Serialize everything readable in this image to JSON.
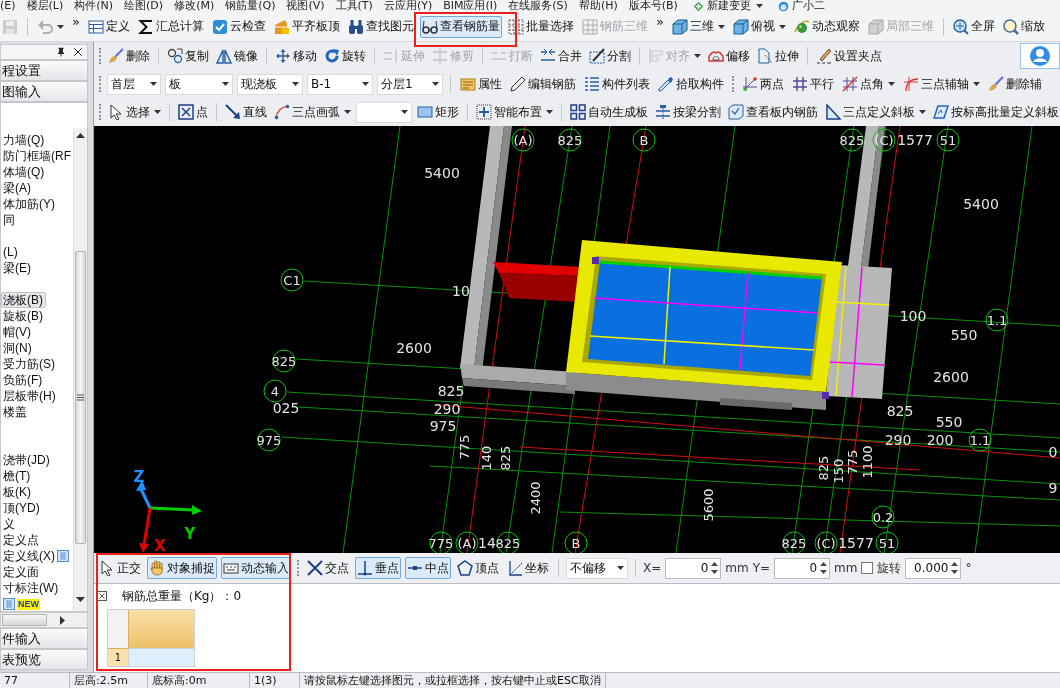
{
  "menu_bar": {
    "items": [
      "(E)",
      "楼层(L)",
      "构件(N)",
      "绘图(D)",
      "修改(M)",
      "钢筋量(Q)",
      "视图(V)",
      "工具(T)",
      "云应用(Y)",
      "BIM应用(I)",
      "在线服务(S)",
      "帮助(H)",
      "版本号(B)"
    ],
    "change_button": {
      "label": "新建变更"
    },
    "assistant": {
      "label": "广小二"
    }
  },
  "main_toolbar": [
    {
      "kind": "button",
      "disabled": true,
      "selected": false
    },
    {
      "kind": "separator"
    },
    {
      "kind": "button",
      "disabled": true,
      "selected": false,
      "caret": true
    },
    {
      "kind": "overflow",
      "label": "»"
    },
    {
      "kind": "button",
      "label": "定义",
      "disabled": false,
      "selected": false
    },
    {
      "kind": "button",
      "label": "汇总计算",
      "disabled": false,
      "selected": false
    },
    {
      "kind": "button",
      "label": "云检查",
      "disabled": false,
      "selected": false
    },
    {
      "kind": "button",
      "label": "平齐板顶",
      "disabled": false,
      "selected": false
    },
    {
      "kind": "button",
      "label": "查找图元",
      "disabled": false,
      "selected": false
    },
    {
      "kind": "button",
      "label": "查看钢筋量",
      "disabled": false,
      "selected": true
    },
    {
      "kind": "button",
      "label": "批量选择",
      "disabled": false,
      "selected": false
    },
    {
      "kind": "button",
      "label": "钢筋三维",
      "disabled": true,
      "selected": false
    },
    {
      "kind": "overflow",
      "label": "»"
    },
    {
      "kind": "button",
      "label": "三维",
      "disabled": false,
      "selected": false,
      "caret": true
    },
    {
      "kind": "button",
      "label": "俯视",
      "disabled": false,
      "selected": false,
      "caret": true
    },
    {
      "kind": "button",
      "label": "动态观察",
      "disabled": false,
      "selected": false
    },
    {
      "kind": "button",
      "label": "局部三维",
      "disabled": true,
      "selected": false
    },
    {
      "kind": "separator"
    },
    {
      "kind": "button",
      "label": "全屏",
      "disabled": false,
      "selected": false
    },
    {
      "kind": "button",
      "label": "缩放",
      "disabled": false,
      "selected": false
    }
  ],
  "edit_toolbar": [
    {
      "kind": "grip"
    },
    {
      "kind": "button",
      "label": "删除",
      "disabled": false,
      "selected": false
    },
    {
      "kind": "separator"
    },
    {
      "kind": "button",
      "label": "复制",
      "disabled": false,
      "selected": false
    },
    {
      "kind": "button",
      "label": "镜像",
      "disabled": false,
      "selected": false
    },
    {
      "kind": "separator"
    },
    {
      "kind": "button",
      "label": "移动",
      "disabled": false,
      "selected": false
    },
    {
      "kind": "button",
      "label": "旋转",
      "disabled": false,
      "selected": false
    },
    {
      "kind": "separator"
    },
    {
      "kind": "button",
      "label": "延伸",
      "disabled": true,
      "selected": false
    },
    {
      "kind": "button",
      "label": "修剪",
      "disabled": true,
      "selected": false
    },
    {
      "kind": "separator"
    },
    {
      "kind": "button",
      "label": "打断",
      "disabled": true,
      "selected": false
    },
    {
      "kind": "button",
      "label": "合并",
      "disabled": false,
      "selected": false
    },
    {
      "kind": "button",
      "label": "分割",
      "disabled": false,
      "selected": false
    },
    {
      "kind": "separator"
    },
    {
      "kind": "button",
      "label": "对齐",
      "disabled": true,
      "selected": false,
      "caret": true
    },
    {
      "kind": "button",
      "label": "偏移",
      "disabled": false,
      "selected": false
    },
    {
      "kind": "button",
      "label": "拉伸",
      "disabled": false,
      "selected": false
    },
    {
      "kind": "separator"
    },
    {
      "kind": "button",
      "label": "设置夹点",
      "disabled": false,
      "selected": false
    }
  ],
  "component_toolbar": [
    {
      "kind": "grip"
    },
    {
      "kind": "dropdown",
      "value": "首层"
    },
    {
      "kind": "dropdown",
      "value": "板"
    },
    {
      "kind": "dropdown",
      "value": "现浇板"
    },
    {
      "kind": "dropdown",
      "value": "B-1"
    },
    {
      "kind": "dropdown",
      "value": "分层1"
    },
    {
      "kind": "separator"
    },
    {
      "kind": "button",
      "label": "属性",
      "disabled": false,
      "selected": false
    },
    {
      "kind": "button",
      "label": "编辑钢筋",
      "disabled": false,
      "selected": false
    },
    {
      "kind": "button",
      "label": "构件列表",
      "disabled": false,
      "selected": false
    },
    {
      "kind": "button",
      "label": "拾取构件",
      "disabled": false,
      "selected": false
    },
    {
      "kind": "grip"
    },
    {
      "kind": "button",
      "label": "两点",
      "disabled": false,
      "selected": false
    },
    {
      "kind": "button",
      "label": "平行",
      "disabled": false,
      "selected": false
    },
    {
      "kind": "button",
      "label": "点角",
      "disabled": false,
      "selected": false,
      "caret": true
    },
    {
      "kind": "button",
      "label": "三点辅轴",
      "disabled": false,
      "selected": false,
      "caret": true
    },
    {
      "kind": "button",
      "label": "删除辅",
      "disabled": false,
      "selected": false
    }
  ],
  "draw_toolbar": [
    {
      "kind": "grip"
    },
    {
      "kind": "button",
      "label": "选择",
      "disabled": false,
      "selected": false,
      "caret": true
    },
    {
      "kind": "separator"
    },
    {
      "kind": "button",
      "label": "点",
      "disabled": false,
      "selected": false
    },
    {
      "kind": "separator"
    },
    {
      "kind": "button",
      "label": "直线",
      "disabled": false,
      "selected": false
    },
    {
      "kind": "button",
      "label": "三点画弧",
      "disabled": false,
      "selected": false,
      "caret": true
    },
    {
      "kind": "dropdown"
    },
    {
      "kind": "button",
      "label": "矩形",
      "disabled": false,
      "selected": false
    },
    {
      "kind": "separator"
    },
    {
      "kind": "button",
      "label": "智能布置",
      "disabled": false,
      "selected": false,
      "caret": true
    },
    {
      "kind": "separator"
    },
    {
      "kind": "button",
      "label": "自动生成板",
      "disabled": false,
      "selected": false
    },
    {
      "kind": "button",
      "label": "按梁分割",
      "disabled": false,
      "selected": false
    },
    {
      "kind": "button",
      "label": "查看板内钢筋",
      "disabled": false,
      "selected": false
    },
    {
      "kind": "button",
      "label": "三点定义斜板",
      "disabled": false,
      "selected": false,
      "caret": true
    },
    {
      "kind": "button",
      "label": "按标高批量定义斜板",
      "disabled": false,
      "selected": false
    }
  ],
  "left_panel": {
    "sections": [
      {
        "label": "程设置"
      },
      {
        "label": "图输入"
      }
    ],
    "tree": [
      {
        "label": "力墙(Q)",
        "selected": false
      },
      {
        "label": "防门框墙(RF",
        "selected": false
      },
      {
        "label": "体墙(Q)",
        "selected": false
      },
      {
        "label": "梁(A)",
        "selected": false
      },
      {
        "label": "体加筋(Y)",
        "selected": false
      },
      {
        "label": "同",
        "selected": false
      },
      {
        "expanded": true,
        "children": [
          {
            "label": "(L)",
            "selected": false
          },
          {
            "label": "梁(E)",
            "selected": false
          }
        ]
      },
      {
        "expanded": true,
        "children": [
          {
            "label": "浇板(B)",
            "selected": true
          },
          {
            "label": "旋板(B)",
            "selected": false
          },
          {
            "label": "帽(V)",
            "selected": false
          },
          {
            "label": "洞(N)",
            "selected": false
          },
          {
            "label": "受力筋(S)",
            "selected": false
          },
          {
            "label": "负筋(F)",
            "selected": false
          },
          {
            "label": "层板带(H)",
            "selected": false
          },
          {
            "label": "楼盖",
            "selected": false
          }
        ]
      },
      {
        "expanded": true,
        "children": [
          {
            "label": "浇带(JD)",
            "selected": false
          },
          {
            "label": "檐(T)",
            "selected": false
          },
          {
            "label": "板(K)",
            "selected": false
          },
          {
            "label": "顶(YD)",
            "selected": false
          }
        ]
      },
      {
        "label": "义",
        "selected": false,
        "expanded": true,
        "children": [
          {
            "label": "定义点",
            "selected": false
          },
          {
            "label": "定义线(X)",
            "selected": false,
            "has_icon": true
          },
          {
            "label": "定义面",
            "selected": false
          },
          {
            "label": "寸标注(W)",
            "selected": false
          },
          {
            "badge": "NEW",
            "selected": false,
            "has_icon": true
          }
        ]
      }
    ],
    "bottom_sections": [
      {
        "label": "件输入"
      },
      {
        "label": "表预览"
      }
    ]
  },
  "viewport": {
    "labels": [
      {
        "text": "(A)",
        "kind": "bubble"
      },
      {
        "text": "825",
        "kind": "bubble"
      },
      {
        "text": "B",
        "kind": "bubble"
      },
      {
        "text": "825",
        "kind": "bubble"
      },
      {
        "text": "(C)",
        "kind": "bubble"
      },
      {
        "text": "1577",
        "kind": "dimension"
      },
      {
        "text": "51",
        "kind": "bubble"
      },
      {
        "text": "5400",
        "kind": "dimension"
      },
      {
        "text": "5400",
        "kind": "dimension"
      },
      {
        "text": "C1",
        "kind": "bubble"
      },
      {
        "text": "10",
        "kind": "dimension"
      },
      {
        "text": "100",
        "kind": "dimension"
      },
      {
        "text": "1.1",
        "kind": "bubble"
      },
      {
        "text": "550",
        "kind": "dimension"
      },
      {
        "text": "2600",
        "kind": "dimension"
      },
      {
        "text": "825",
        "kind": "bubble"
      },
      {
        "text": "2600",
        "kind": "dimension"
      },
      {
        "text": "4",
        "kind": "bubble"
      },
      {
        "text": "825",
        "kind": "dimension"
      },
      {
        "text": "025",
        "kind": "dimension"
      },
      {
        "text": "290",
        "kind": "dimension"
      },
      {
        "text": "825",
        "kind": "dimension"
      },
      {
        "text": "975",
        "kind": "dimension"
      },
      {
        "text": "550",
        "kind": "dimension"
      },
      {
        "text": "975",
        "kind": "bubble"
      },
      {
        "text": "775",
        "kind": "vertical"
      },
      {
        "text": "290",
        "kind": "dimension"
      },
      {
        "text": "200",
        "kind": "dimension"
      },
      {
        "text": "1.1",
        "kind": "bubble"
      },
      {
        "text": "140",
        "kind": "vertical"
      },
      {
        "text": "825",
        "kind": "vertical"
      },
      {
        "text": "825",
        "kind": "vertical"
      },
      {
        "text": "150",
        "kind": "vertical"
      },
      {
        "text": "775",
        "kind": "vertical"
      },
      {
        "text": "1100",
        "kind": "vertical"
      },
      {
        "text": "0",
        "kind": "dimension"
      },
      {
        "text": "2400",
        "kind": "vertical"
      },
      {
        "text": "5600",
        "kind": "vertical"
      },
      {
        "text": "9",
        "kind": "dimension"
      },
      {
        "text": "0.2",
        "kind": "bubble"
      },
      {
        "text": "775",
        "kind": "bubble"
      },
      {
        "text": "(A)",
        "kind": "bubble"
      },
      {
        "text": "14",
        "kind": "dimension"
      },
      {
        "text": "825",
        "kind": "bubble"
      },
      {
        "text": "B",
        "kind": "bubble"
      },
      {
        "text": "825",
        "kind": "bubble"
      },
      {
        "text": "(C)",
        "kind": "bubble"
      },
      {
        "text": "1577",
        "kind": "dimension"
      },
      {
        "text": "51",
        "kind": "bubble"
      }
    ],
    "axes": [
      {
        "label": "Z",
        "color": "#1e90ff"
      },
      {
        "label": "Y",
        "color": "#00d000"
      },
      {
        "label": "X",
        "color": "#e00000"
      }
    ]
  },
  "snap_toolbar": [
    {
      "kind": "button",
      "label": "正交",
      "disabled": false,
      "selected": false
    },
    {
      "kind": "button",
      "label": "对象捕捉",
      "disabled": false,
      "selected": true
    },
    {
      "kind": "button",
      "label": "动态输入",
      "disabled": false,
      "selected": true
    },
    {
      "kind": "grip"
    },
    {
      "kind": "button",
      "label": "交点",
      "disabled": false,
      "selected": false
    },
    {
      "kind": "button",
      "label": "垂点",
      "disabled": false,
      "selected": true
    },
    {
      "kind": "button",
      "label": "中点",
      "disabled": false,
      "selected": true
    },
    {
      "kind": "button",
      "label": "顶点",
      "disabled": false,
      "selected": false
    },
    {
      "kind": "button",
      "label": "坐标",
      "disabled": false,
      "selected": false
    },
    {
      "kind": "separator"
    },
    {
      "kind": "dropdown",
      "value": "不偏移"
    },
    {
      "kind": "separator"
    },
    {
      "kind": "label",
      "label": "X="
    },
    {
      "kind": "spinner",
      "value": "0"
    },
    {
      "kind": "label",
      "label": "mm"
    },
    {
      "kind": "label",
      "label": "Y="
    },
    {
      "kind": "spinner",
      "value": "0"
    },
    {
      "kind": "label",
      "label": "mm"
    },
    {
      "kind": "checkbox",
      "checked": false
    },
    {
      "kind": "label",
      "label": "旋转"
    },
    {
      "kind": "spinner",
      "value": "0.000"
    },
    {
      "kind": "label",
      "label": "°"
    }
  ],
  "rebar_panel": {
    "title": "钢筋总重量（Kg）：0",
    "rows": [
      {
        "number": "1",
        "selected": true
      }
    ]
  },
  "status_bar": [
    "77",
    "层高:2.5m",
    "底标高:0m",
    "1(3)",
    "请按鼠标左键选择图元，或拉框选择，按右键中止或ESC取消"
  ]
}
